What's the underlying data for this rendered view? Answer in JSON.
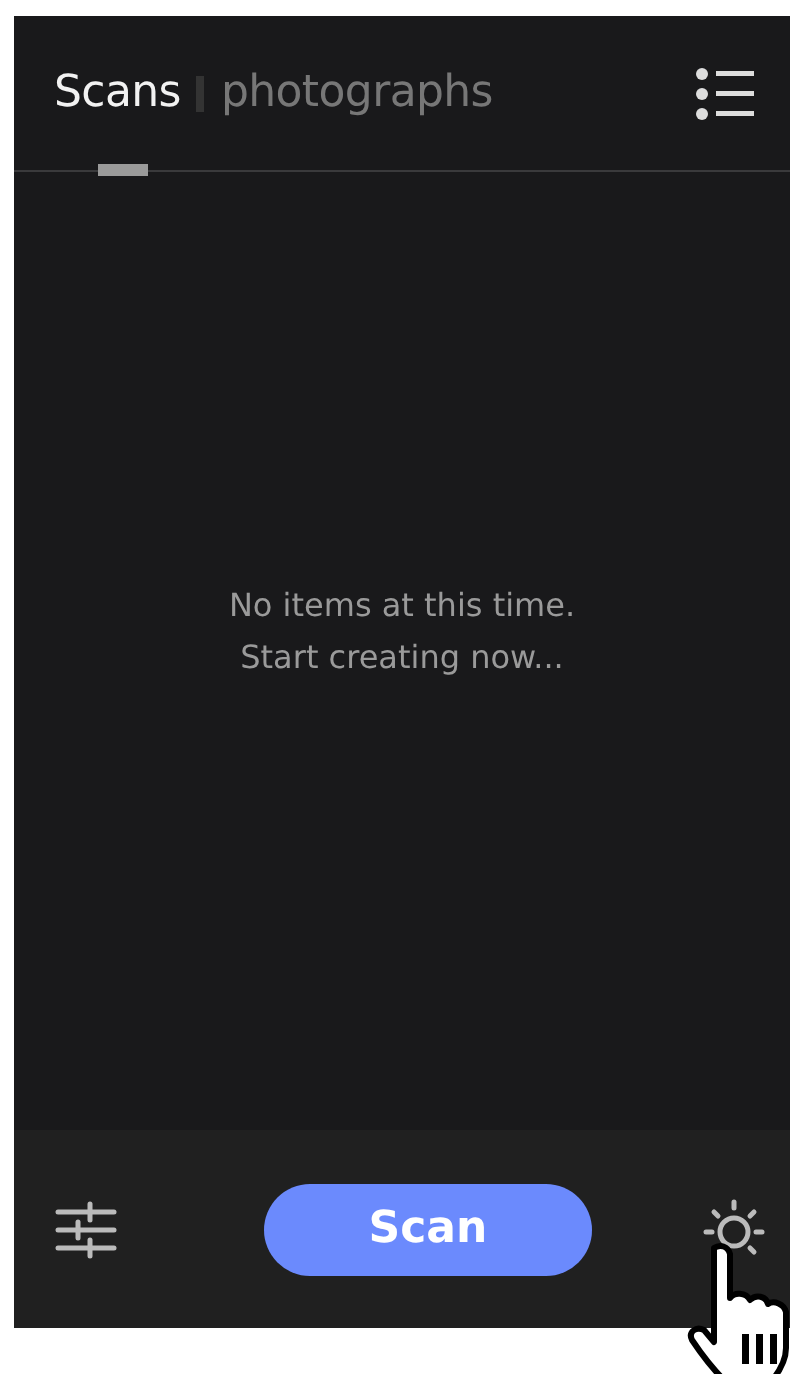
{
  "tabs": [
    {
      "label": "Scans",
      "selected": true
    },
    {
      "label": "photographs",
      "selected": false
    }
  ],
  "empty_state": {
    "lines": [
      "No items at this time.",
      "Start creating now..."
    ]
  },
  "bottom_bar": {
    "scan_button": "Scan"
  }
}
